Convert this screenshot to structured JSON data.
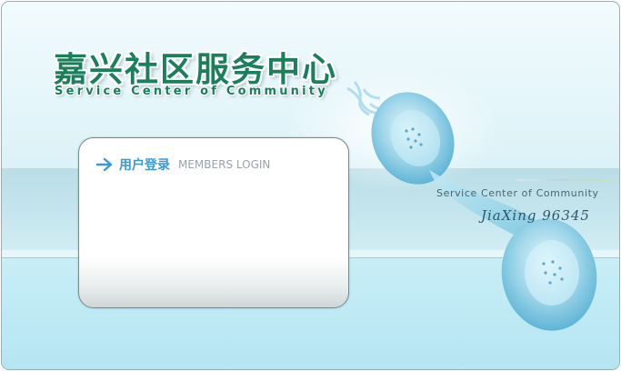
{
  "header": {
    "title_cn": "嘉兴社区服务中心",
    "title_en": "Service Center of Community"
  },
  "login": {
    "icon": "arrow-right-icon",
    "title_cn": "用户登录",
    "title_en": "MEMBERS LOGIN"
  },
  "info": {
    "service_text": "Service Center of Community",
    "hotline": "JiaXing 96345"
  },
  "colors": {
    "title_green": "#1a7f5a",
    "login_blue": "#3a98d6",
    "background": "#cdeef6"
  }
}
